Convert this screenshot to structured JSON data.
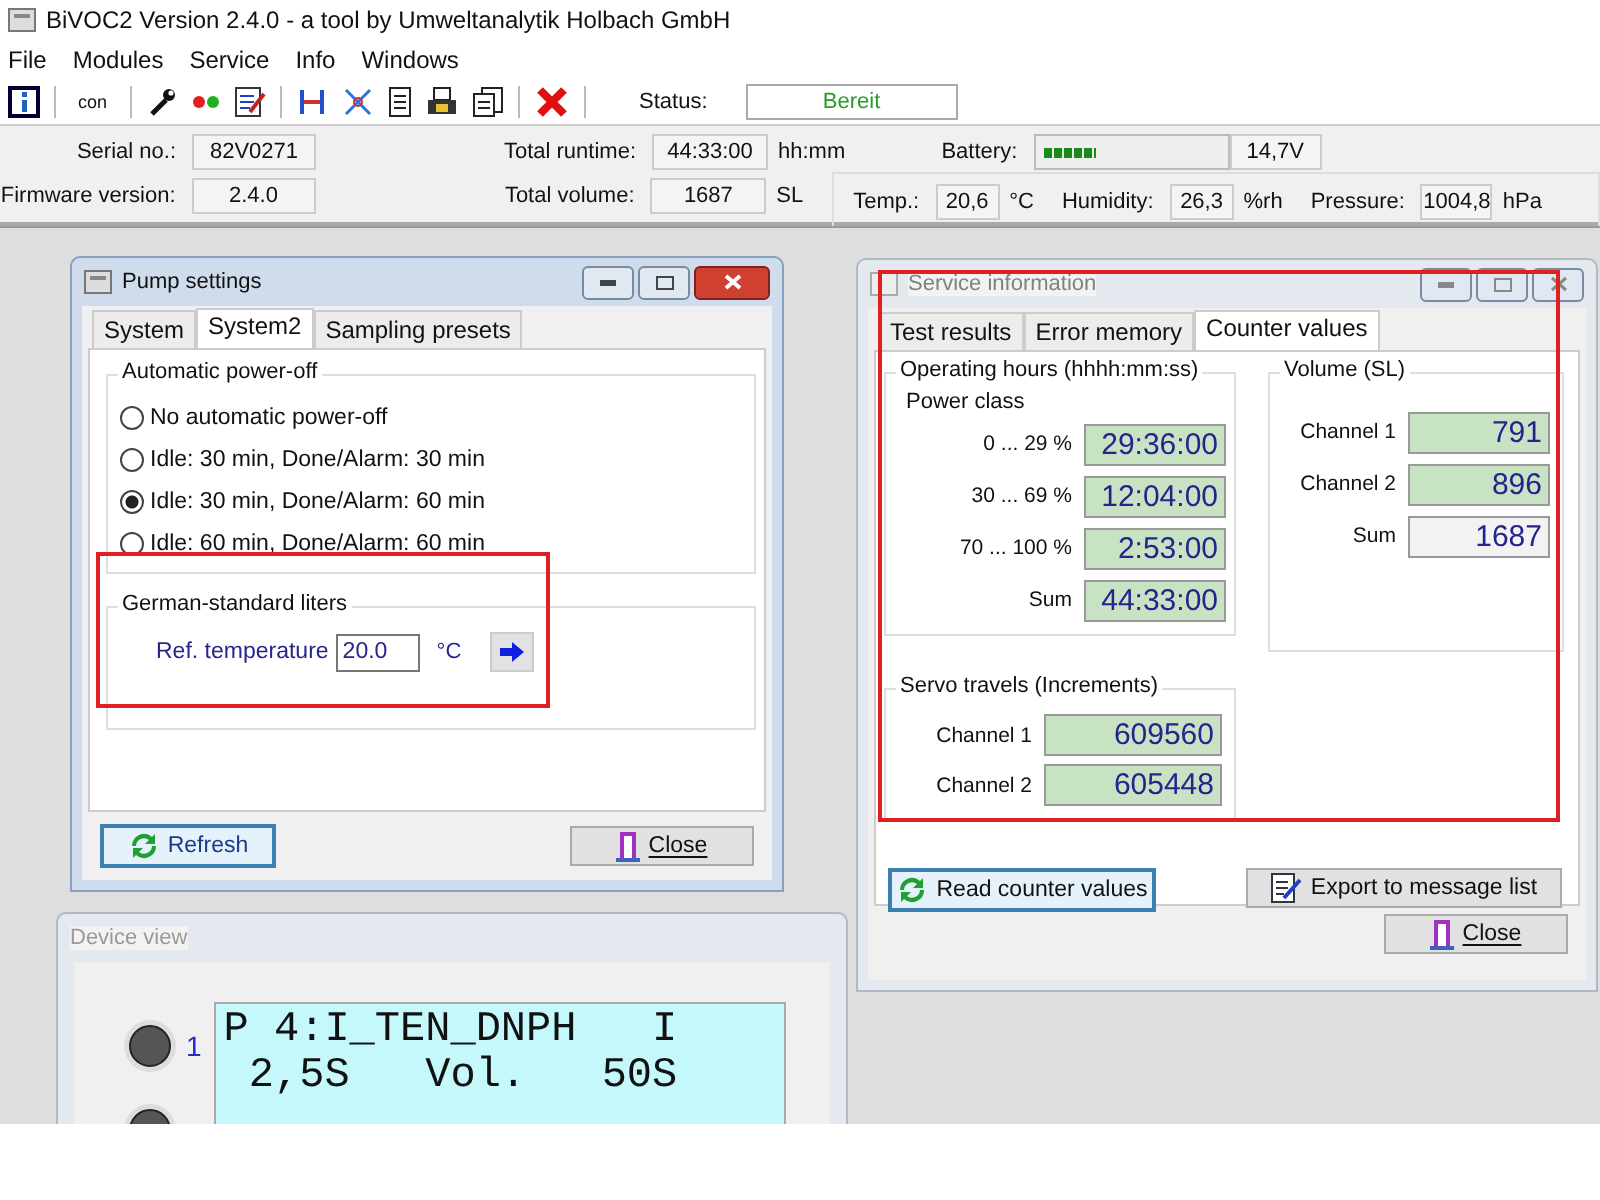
{
  "window": {
    "title": "BiVOC2 Version 2.4.0 - a tool by Umweltanalytik Holbach GmbH"
  },
  "menu": [
    "File",
    "Modules",
    "Service",
    "Info",
    "Windows"
  ],
  "toolbar": {
    "con_label": "con",
    "status_label": "Status:",
    "status_value": "Bereit"
  },
  "info": {
    "serial_label": "Serial no.:",
    "serial": "82V0271",
    "firmware_label": "Firmware version:",
    "firmware": "2.4.0",
    "runtime_label": "Total runtime:",
    "runtime": "44:33:00",
    "runtime_unit": "hh:mm",
    "volume_label": "Total volume:",
    "volume": "1687",
    "volume_unit": "SL",
    "battery_label": "Battery:",
    "battery": {
      "level": 0.3
    },
    "battery_voltage": "14,7V",
    "temp_label": "Temp.:",
    "temp": "20,6",
    "temp_unit": "°C",
    "humidity_label": "Humidity:",
    "humidity": "26,3",
    "humidity_unit": "%rh",
    "pressure_label": "Pressure:",
    "pressure": "1004,8",
    "pressure_unit": "hPa"
  },
  "pump_settings": {
    "title": "Pump settings",
    "tabs": [
      {
        "label": "System",
        "selected": false
      },
      {
        "label": "System2",
        "selected": true
      },
      {
        "label": "Sampling presets",
        "selected": false
      }
    ],
    "power_off": {
      "title": "Automatic power-off",
      "options": [
        {
          "label": "No automatic power-off",
          "selected": false
        },
        {
          "label": "Idle: 30 min, Done/Alarm: 30 min",
          "selected": false
        },
        {
          "label": "Idle: 30 min, Done/Alarm: 60 min",
          "selected": true
        },
        {
          "label": "Idle: 60 min, Done/Alarm: 60 min",
          "selected": false
        }
      ]
    },
    "standard_liters": {
      "title": "German-standard liters",
      "ref_label": "Ref. temperature",
      "ref_value": "20.0",
      "unit": "°C"
    },
    "buttons": {
      "refresh": "Refresh",
      "close": "Close"
    }
  },
  "service_info": {
    "title": "Service information",
    "tabs": [
      {
        "label": "Test results",
        "selected": false
      },
      {
        "label": "Error memory",
        "selected": false
      },
      {
        "label": "Counter values",
        "selected": true
      }
    ],
    "operating_hours": {
      "title": "Operating hours (hhhh:mm:ss)",
      "subtitle": "Power class",
      "rows": [
        {
          "label": "0 ... 29 %",
          "value": "29:36:00"
        },
        {
          "label": "30 ... 69 %",
          "value": "12:04:00"
        },
        {
          "label": "70 ... 100 %",
          "value": "2:53:00"
        },
        {
          "label": "Sum",
          "value": "44:33:00"
        }
      ]
    },
    "volume": {
      "title": "Volume (SL)",
      "rows": [
        {
          "label": "Channel 1",
          "value": "791",
          "highlighted": true
        },
        {
          "label": "Channel 2",
          "value": "896",
          "highlighted": true
        },
        {
          "label": "Sum",
          "value": "1687",
          "highlighted": false
        }
      ]
    },
    "servo": {
      "title": "Servo travels (Increments)",
      "rows": [
        {
          "label": "Channel 1",
          "value": "609560"
        },
        {
          "label": "Channel 2",
          "value": "605448"
        }
      ]
    },
    "buttons": {
      "read": "Read counter values",
      "export": "Export to message list",
      "close": "Close"
    }
  },
  "device_view": {
    "title": "Device view",
    "button_label": "1",
    "display_lines": [
      "P 4:I_TEN_DNPH   I",
      " 2,5S   Vol.   50S"
    ]
  }
}
